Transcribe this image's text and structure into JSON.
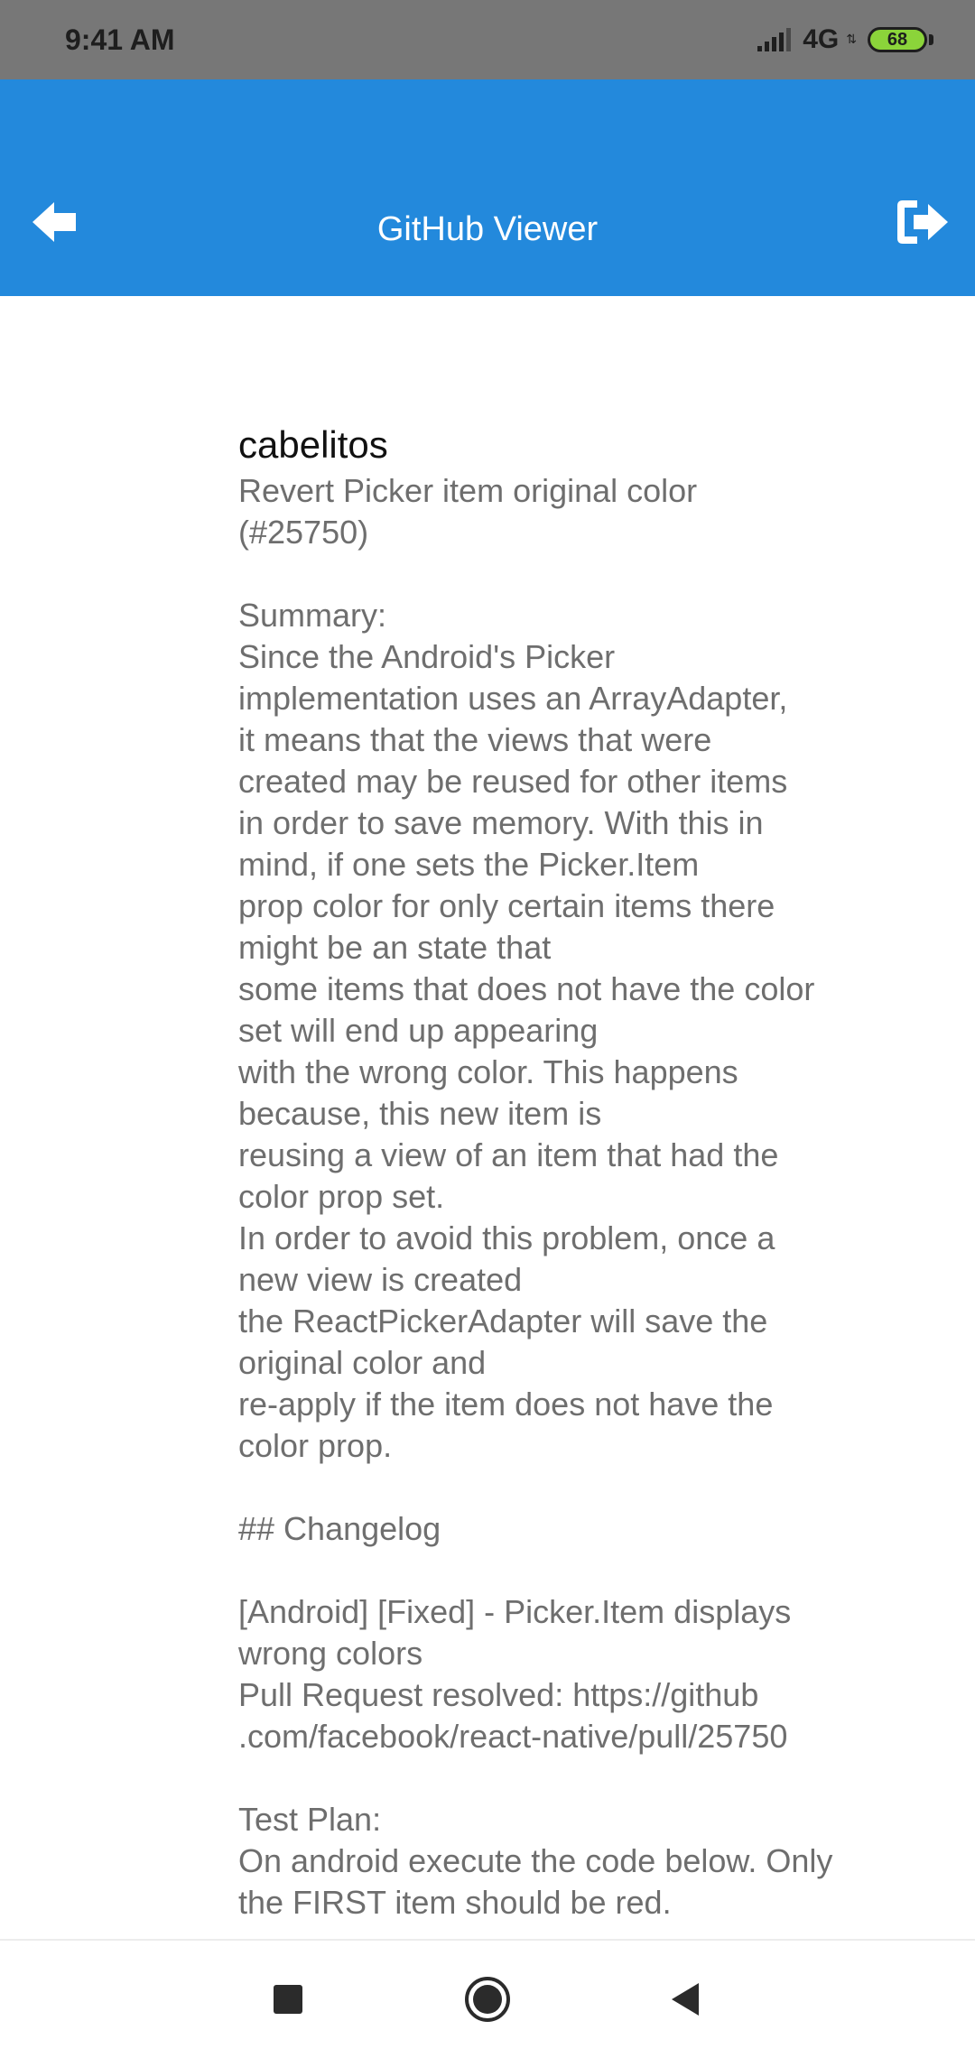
{
  "status_bar": {
    "time": "9:41 AM",
    "network": "4G",
    "battery": "68",
    "icons": [
      "signal-icon",
      "battery-icon"
    ]
  },
  "app_bar": {
    "title": "GitHub Viewer",
    "left_icon": "back-arrow-icon",
    "right_icon": "logout-icon",
    "color": "#2389dc"
  },
  "commit": {
    "author": "cabelitos",
    "message": "Revert Picker item original color\n(#25750)\n\nSummary:\nSince the Android's Picker\nimplementation uses an ArrayAdapter,\nit means that the views that were\ncreated may be reused for other items\nin order to save memory. With this in\nmind, if one sets the Picker.Item\nprop color for only certain items there\nmight be an state that\nsome items that does not have the color\nset will end up appearing\nwith the wrong color. This happens\nbecause, this new item is\nreusing a view of an item that had the\ncolor prop set.\nIn order to avoid this problem, once a\nnew view is created\nthe ReactPickerAdapter will save the\noriginal color and\nre-apply if the item does not have the\ncolor prop.\n\n## Changelog\n\n[Android] [Fixed] - Picker.Item displays\nwrong colors\nPull Request resolved: https://github\n.com/facebook/react-native/pull/25750\n\nTest Plan:\nOn android execute the code below. Only\nthe FIRST item should be red."
  },
  "nav_bar": {
    "icons": [
      "recent-apps-icon",
      "home-icon",
      "back-icon"
    ]
  }
}
